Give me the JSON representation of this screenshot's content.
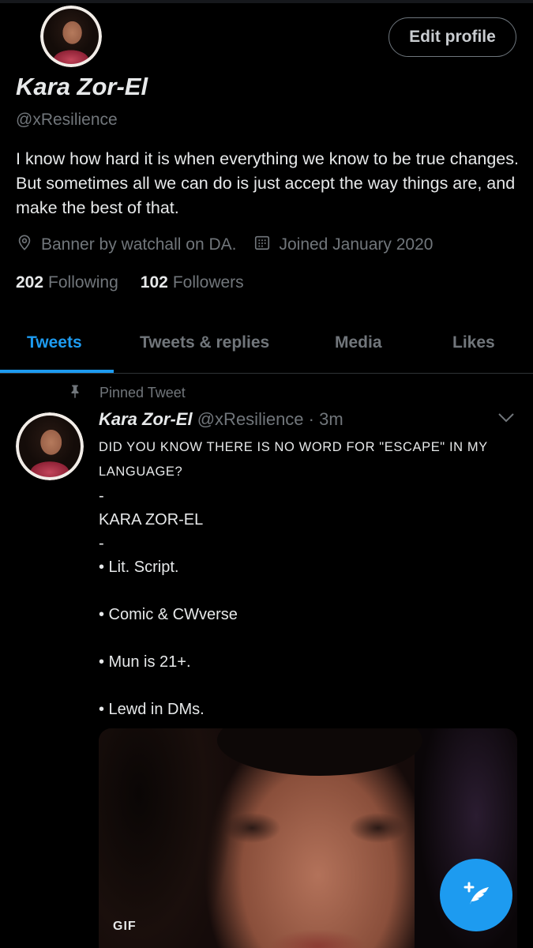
{
  "profile": {
    "edit_button": "Edit profile",
    "name": "Kara Zor-El",
    "handle": "@xResilience",
    "bio": "I know how hard it is when everything we know to be true changes. But sometimes all we can do is just accept the way things are, and make the best of that.",
    "location": "Banner by watchall on DA.",
    "joined": "Joined January 2020",
    "following_count": "202",
    "following_label": "Following",
    "followers_count": "102",
    "followers_label": "Followers"
  },
  "tabs": [
    {
      "label": "Tweets",
      "active": true
    },
    {
      "label": "Tweets & replies",
      "active": false
    },
    {
      "label": "Media",
      "active": false
    },
    {
      "label": "Likes",
      "active": false
    }
  ],
  "tweet": {
    "pinned_label": "Pinned Tweet",
    "author_name": "Kara Zor-El",
    "author_handle": "@xResilience",
    "separator": "·",
    "time": "3m",
    "line1": "DID YOU KNOW THERE IS NO WORD FOR \"ESCAPE\" IN MY LANGUAGE?",
    "dash1": "-",
    "line2": "KARA ZOR-EL",
    "dash2": "-",
    "bullets": [
      "• Lit. Script.",
      "• Comic & CWverse",
      "• Mun is 21+.",
      "• Lewd in DMs."
    ],
    "media_badge": "GIF"
  },
  "colors": {
    "accent": "#1d9bf0",
    "background": "#000000",
    "secondary_text": "#71767b"
  },
  "icons": [
    "location-icon",
    "calendar-icon",
    "pin-icon",
    "chevron-down-icon",
    "compose-tweet-icon"
  ]
}
